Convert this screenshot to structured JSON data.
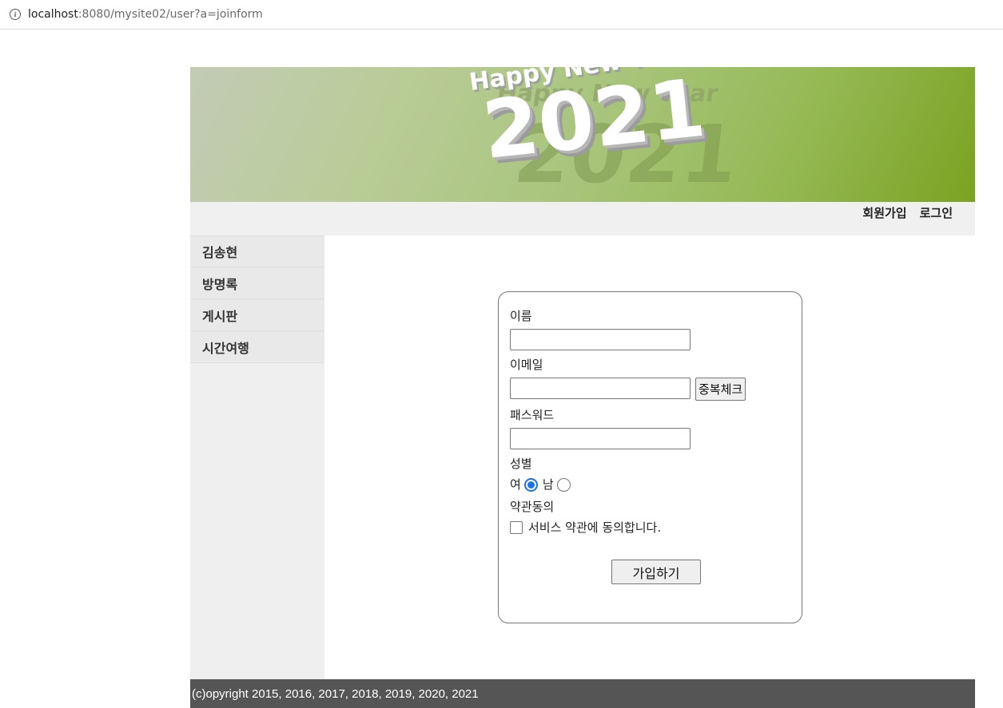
{
  "browser": {
    "url_host": "localhost",
    "url_rest": ":8080/mysite02/user?a=joinform"
  },
  "banner": {
    "heading": "Happy New Year",
    "year": "2021"
  },
  "usernav": {
    "join_label": "회원가입",
    "login_label": "로그인"
  },
  "sidenav": {
    "items": [
      {
        "label": "김송현"
      },
      {
        "label": "방명록"
      },
      {
        "label": "게시판"
      },
      {
        "label": "시간여행"
      }
    ]
  },
  "joinform": {
    "name_label": "이름",
    "name_value": "",
    "email_label": "이메일",
    "email_value": "",
    "dup_check_label": "중복체크",
    "password_label": "패스워드",
    "password_value": "",
    "gender_label": "성별",
    "gender_female": "여",
    "gender_male": "남",
    "gender_selected": "여",
    "agree_label": "약관동의",
    "agree_text": "서비스 약관에 동의합니다.",
    "agree_checked": false,
    "submit_label": "가입하기"
  },
  "footer": {
    "copyright": "(c)opyright 2015, 2016, 2017, 2018, 2019, 2020, 2021"
  },
  "colors": {
    "accent_radio": "#1a73e8",
    "footer_bg": "#555555",
    "banner_green": "#7ba221"
  }
}
